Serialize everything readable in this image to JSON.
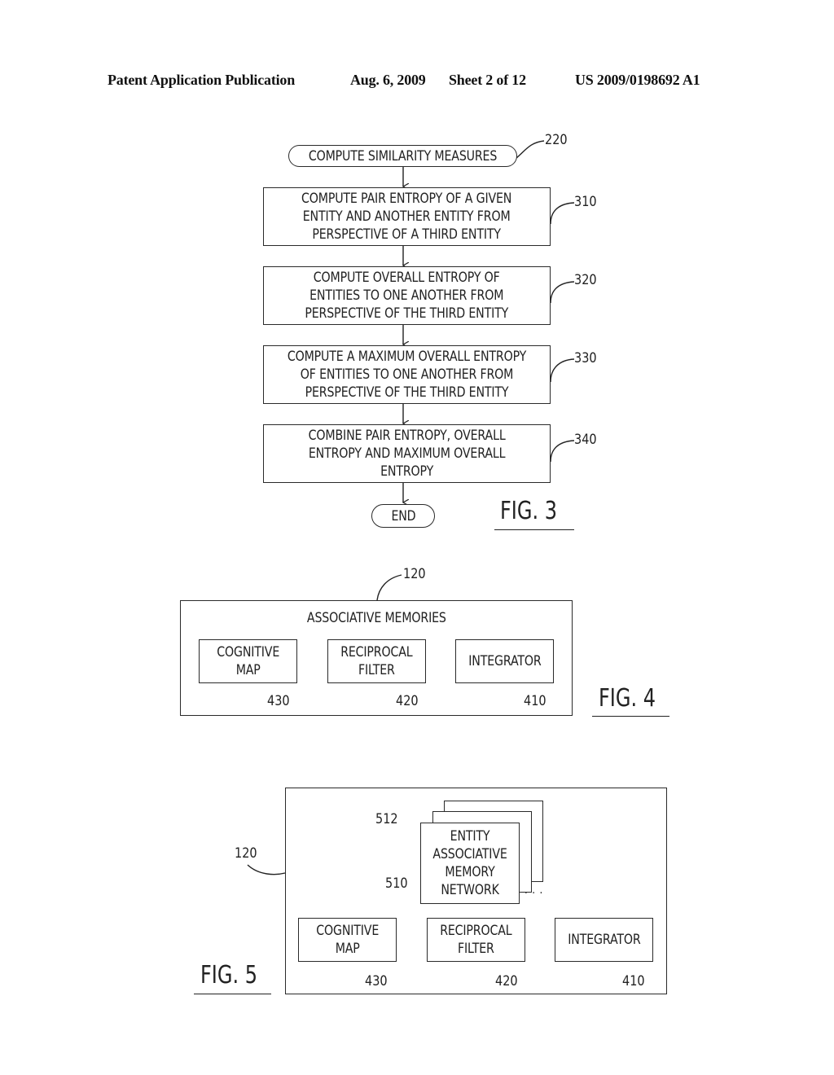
{
  "header": {
    "publication": "Patent Application Publication",
    "date": "Aug. 6, 2009",
    "sheet": "Sheet 2 of 12",
    "number": "US 2009/0198692 A1"
  },
  "fig3": {
    "label": "FIG. 3",
    "start": {
      "text": "COMPUTE SIMILARITY MEASURES",
      "ref": "220"
    },
    "steps": [
      {
        "text": "COMPUTE PAIR ENTROPY OF A GIVEN\nENTITY AND ANOTHER ENTITY FROM\nPERSPECTIVE OF A THIRD ENTITY",
        "ref": "310"
      },
      {
        "text": "COMPUTE OVERALL ENTROPY OF\nENTITIES TO ONE ANOTHER FROM\nPERSPECTIVE OF THE THIRD ENTITY",
        "ref": "320"
      },
      {
        "text": "COMPUTE A MAXIMUM OVERALL ENTROPY\nOF ENTITIES TO ONE ANOTHER FROM\nPERSPECTIVE OF THE THIRD ENTITY",
        "ref": "330"
      },
      {
        "text": "COMBINE PAIR ENTROPY, OVERALL\nENTROPY AND MAXIMUM OVERALL\nENTROPY",
        "ref": "340"
      }
    ],
    "end": {
      "text": "END"
    }
  },
  "fig4": {
    "label": "FIG. 4",
    "container": {
      "title": "ASSOCIATIVE MEMORIES",
      "ref": "120"
    },
    "components": [
      {
        "text": "COGNITIVE\nMAP",
        "ref": "430"
      },
      {
        "text": "RECIPROCAL\nFILTER",
        "ref": "420"
      },
      {
        "text": "INTEGRATOR",
        "ref": "410"
      }
    ]
  },
  "fig5": {
    "label": "FIG. 5",
    "container": {
      "ref": "120"
    },
    "network": {
      "text": "ENTITY\nASSOCIATIVE\nMEMORY\nNETWORK",
      "ref": "510",
      "stack_ref": "512",
      "ellipsis": ". . ."
    },
    "components": [
      {
        "text": "COGNITIVE\nMAP",
        "ref": "430"
      },
      {
        "text": "RECIPROCAL\nFILTER",
        "ref": "420"
      },
      {
        "text": "INTEGRATOR",
        "ref": "410"
      }
    ]
  }
}
